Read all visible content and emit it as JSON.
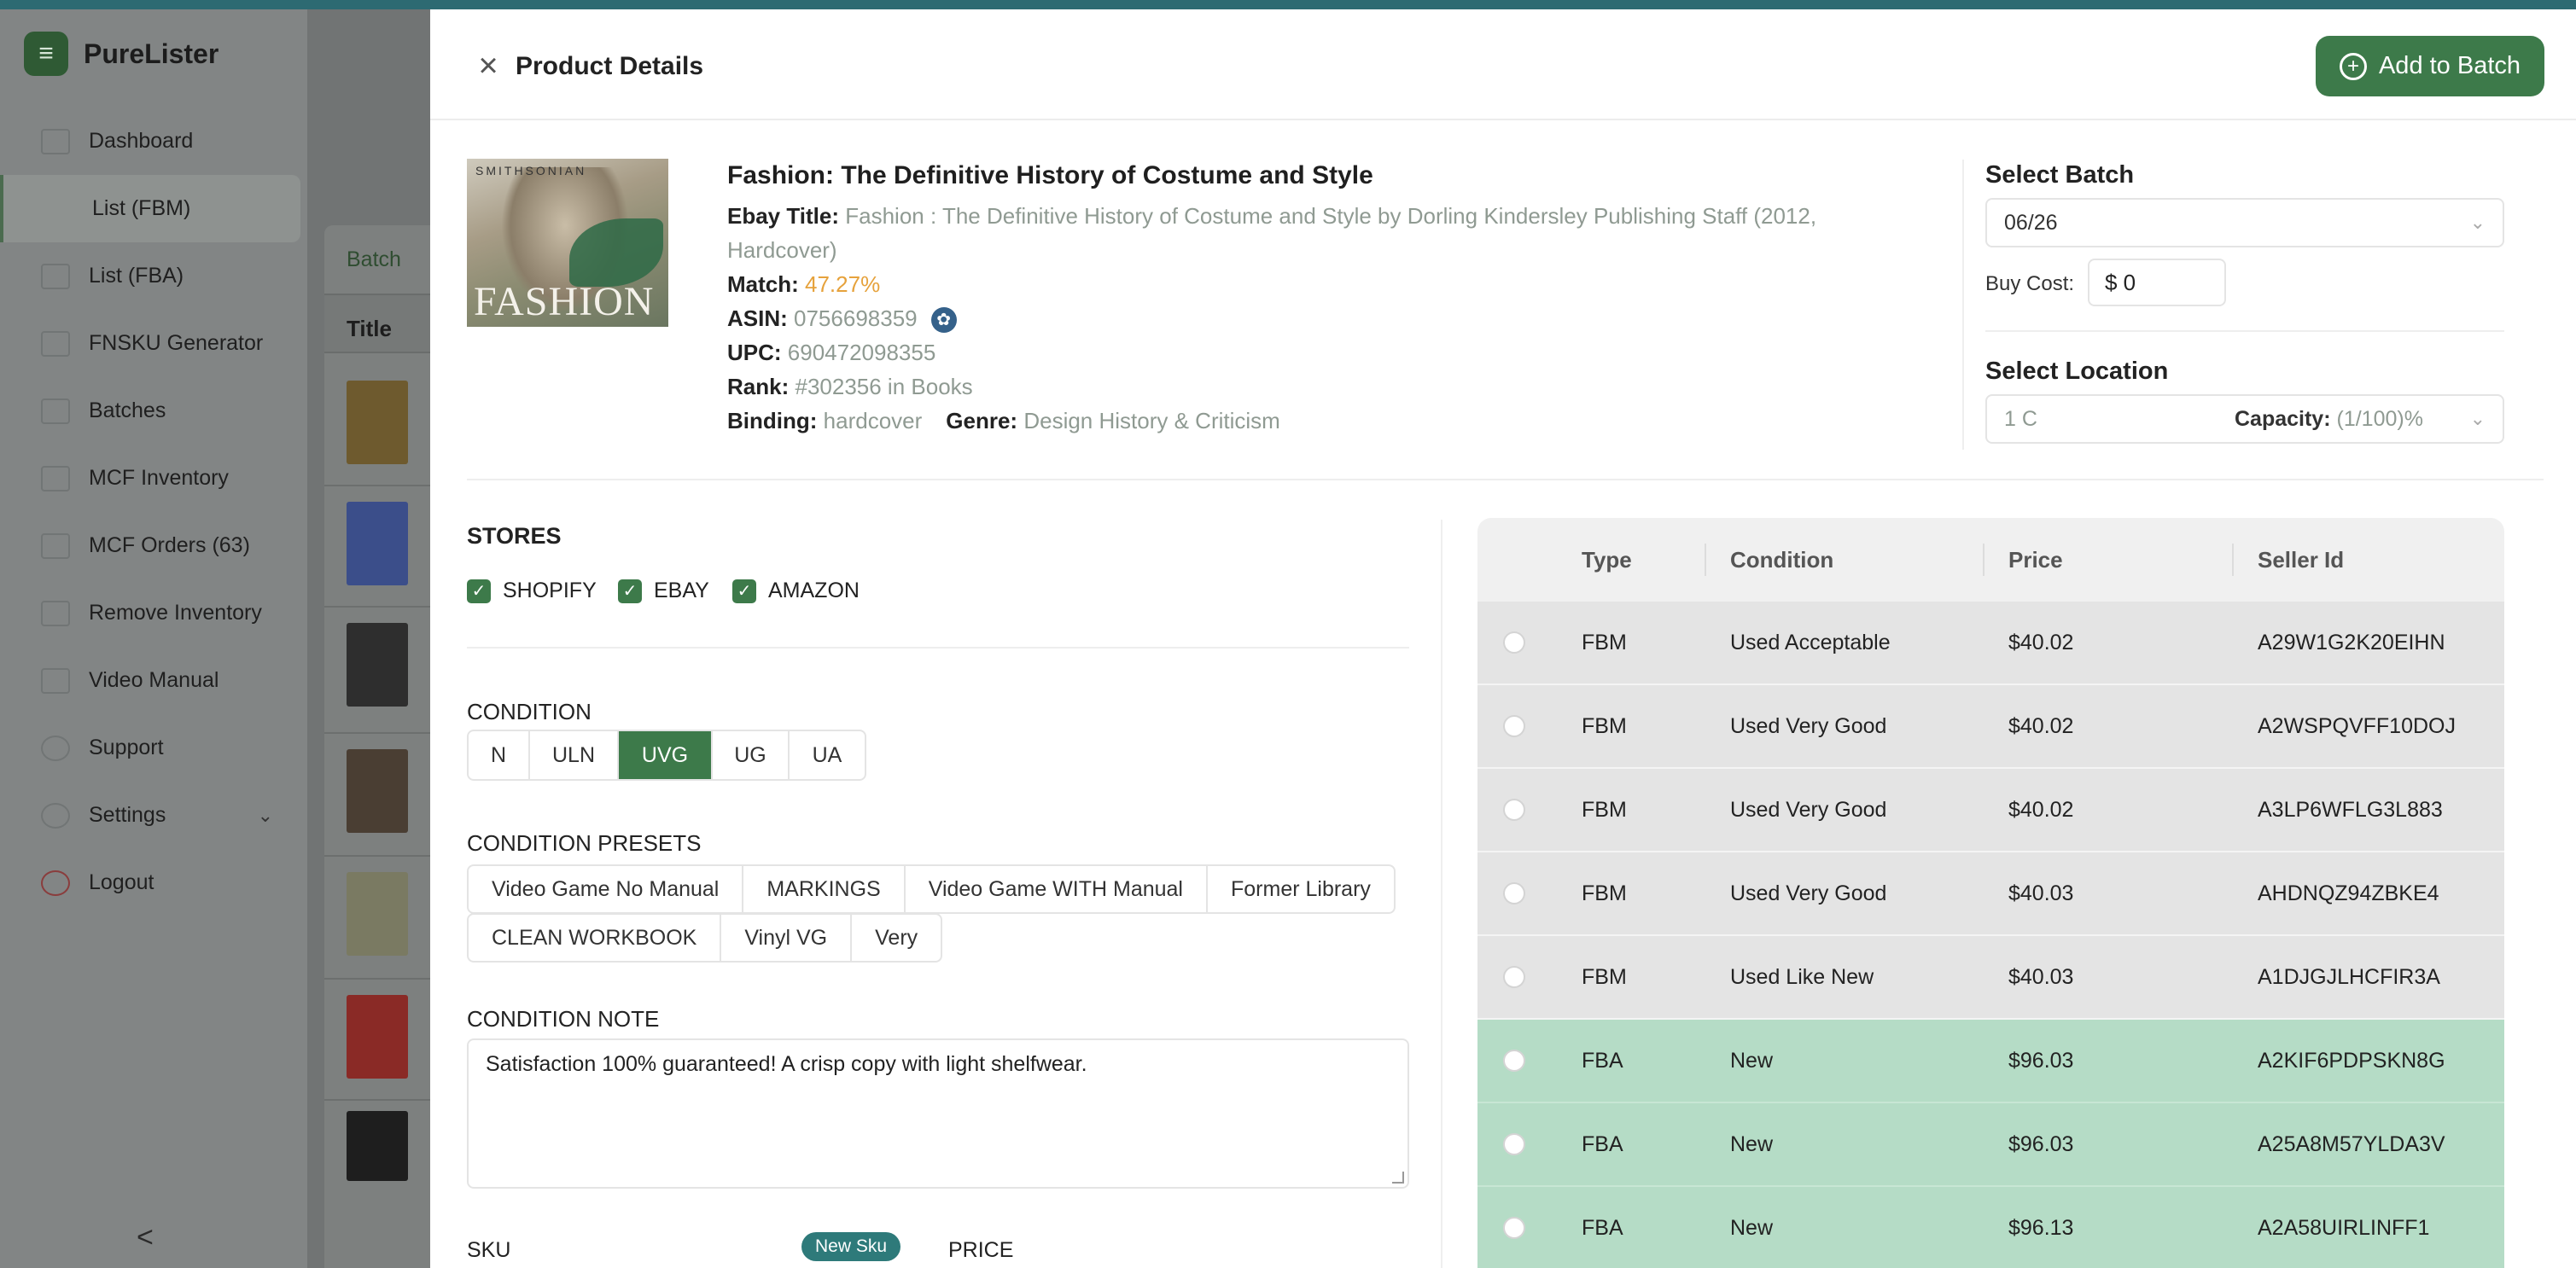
{
  "app": {
    "name": "PureLister"
  },
  "sidebar": {
    "items": [
      {
        "label": "Dashboard",
        "icon": "dashboard-icon"
      },
      {
        "label": "List (FBM)",
        "icon": "list-icon",
        "active": true
      },
      {
        "label": "List (FBA)",
        "icon": "list-icon"
      },
      {
        "label": "FNSKU Generator",
        "icon": "barcode-icon"
      },
      {
        "label": "Batches",
        "icon": "batches-icon"
      },
      {
        "label": "MCF Inventory",
        "icon": "inventory-icon"
      },
      {
        "label": "MCF Orders (63)",
        "icon": "orders-icon"
      },
      {
        "label": "Remove Inventory",
        "icon": "remove-icon"
      },
      {
        "label": "Video Manual",
        "icon": "video-icon"
      },
      {
        "label": "Support",
        "icon": "support-icon"
      },
      {
        "label": "Settings",
        "icon": "gear-icon"
      },
      {
        "label": "Logout",
        "icon": "logout-icon"
      }
    ],
    "collapse_glyph": "<"
  },
  "background": {
    "tab_label": "Batch",
    "column_title": "Title"
  },
  "modal": {
    "title": "Product Details",
    "add_button": "Add to Batch",
    "product": {
      "title": "Fashion: The Definitive History of Costume and Style",
      "ebay_title_label": "Ebay Title:",
      "ebay_title": "Fashion : The Definitive History of Costume and Style by Dorling Kindersley Publishing Staff (2012, Hardcover)",
      "match_label": "Match:",
      "match": "47.27%",
      "asin_label": "ASIN:",
      "asin": "0756698359",
      "upc_label": "UPC:",
      "upc": "690472098355",
      "rank_label": "Rank:",
      "rank": "#302356 in Books",
      "binding_label": "Binding:",
      "binding": "hardcover",
      "genre_label": "Genre:",
      "genre": "Design History & Criticism",
      "cover_top": "SMITHSONIAN",
      "cover_title": "FASHION"
    },
    "batch": {
      "heading": "Select Batch",
      "value": "06/26",
      "buy_cost_label": "Buy Cost:",
      "buy_cost_value": "$ 0"
    },
    "location": {
      "heading": "Select Location",
      "value": "1 C",
      "capacity_label": "Capacity:",
      "capacity_value": "(1/100)%"
    },
    "stores": {
      "heading": "STORES",
      "items": [
        "SHOPIFY",
        "EBAY",
        "AMAZON"
      ]
    },
    "condition": {
      "heading": "CONDITION",
      "options": [
        "N",
        "ULN",
        "UVG",
        "UG",
        "UA"
      ],
      "selected": "UVG"
    },
    "presets": {
      "heading": "CONDITION PRESETS",
      "row1": [
        "Video Game No Manual",
        "MARKINGS",
        "Video Game WITH Manual",
        "Former Library"
      ],
      "row2": [
        "CLEAN WORKBOOK",
        "Vinyl VG",
        "Very"
      ]
    },
    "note": {
      "heading": "CONDITION NOTE",
      "value": "Satisfaction 100% guaranteed!  A crisp copy with light shelfwear."
    },
    "sku": {
      "label": "SKU",
      "badge": "New Sku"
    },
    "price": {
      "label": "PRICE"
    },
    "offers": {
      "columns": [
        "Type",
        "Condition",
        "Price",
        "Seller Id"
      ],
      "rows": [
        {
          "type": "FBM",
          "condition": "Used Acceptable",
          "price": "$40.02",
          "seller": "A29W1G2K20EIHN"
        },
        {
          "type": "FBM",
          "condition": "Used Very Good",
          "price": "$40.02",
          "seller": "A2WSPQVFF10DOJ"
        },
        {
          "type": "FBM",
          "condition": "Used Very Good",
          "price": "$40.02",
          "seller": "A3LP6WFLG3L883"
        },
        {
          "type": "FBM",
          "condition": "Used Very Good",
          "price": "$40.03",
          "seller": "AHDNQZ94ZBKE4"
        },
        {
          "type": "FBM",
          "condition": "Used Like New",
          "price": "$40.03",
          "seller": "A1DJGJLHCFIR3A"
        },
        {
          "type": "FBA",
          "condition": "New",
          "price": "$96.03",
          "seller": "A2KIF6PDPSKN8G"
        },
        {
          "type": "FBA",
          "condition": "New",
          "price": "$96.03",
          "seller": "A25A8M57YLDA3V"
        },
        {
          "type": "FBA",
          "condition": "New",
          "price": "$96.13",
          "seller": "A2A58UIRLINFF1"
        }
      ]
    }
  },
  "colors": {
    "accent": "#3d7a4a",
    "fba_row": "#b5dcc6",
    "fbm_row": "#e4e4e4",
    "match": "#e6a23c",
    "muted": "#8f9a92"
  }
}
